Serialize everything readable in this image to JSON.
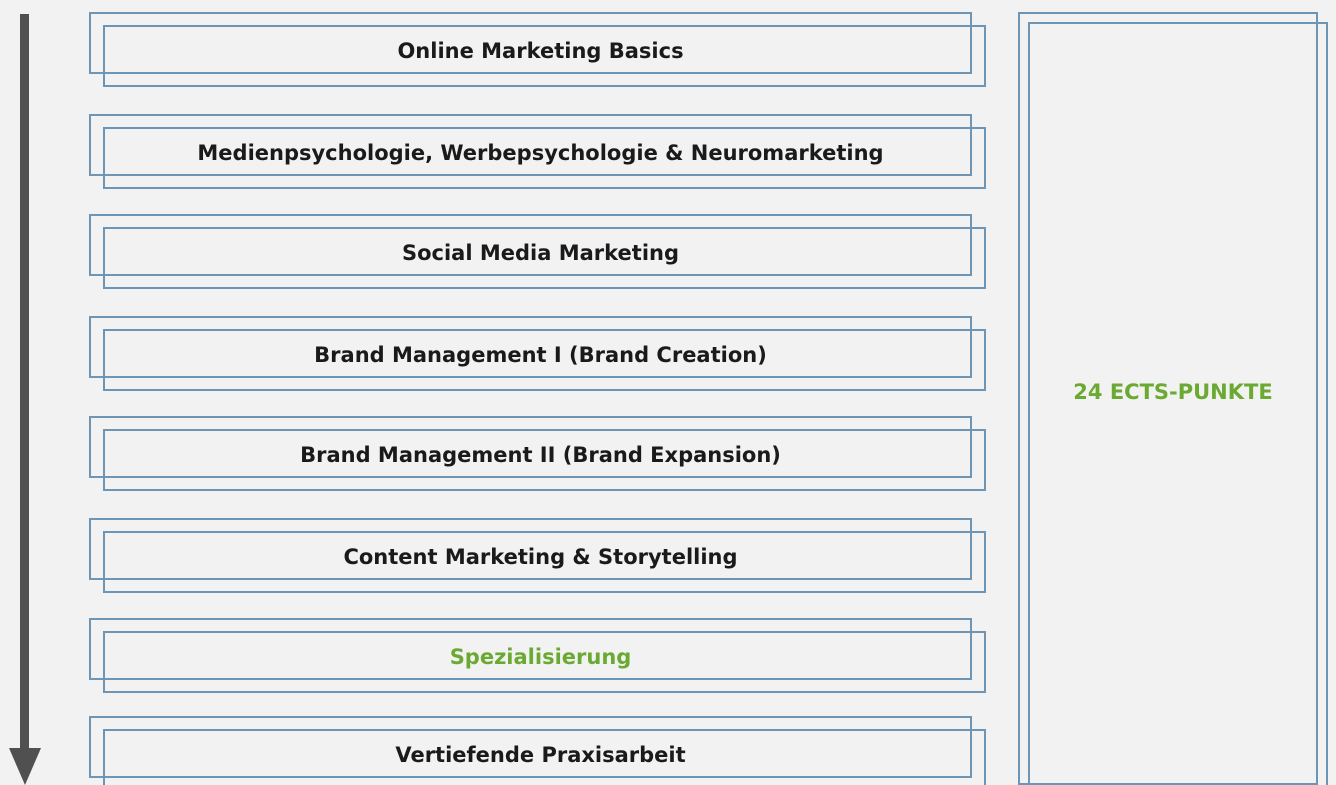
{
  "modules": [
    {
      "label": "Online Marketing Basics",
      "highlight": false
    },
    {
      "label": "Medienpsychologie, Werbepsychologie & Neuromarketing",
      "highlight": false
    },
    {
      "label": "Social Media Marketing",
      "highlight": false
    },
    {
      "label": "Brand Management I (Brand Creation)",
      "highlight": false
    },
    {
      "label": "Brand Management II (Brand Expansion)",
      "highlight": false
    },
    {
      "label": "Content Marketing & Storytelling",
      "highlight": false
    },
    {
      "label": "Spezialisierung",
      "highlight": true
    },
    {
      "label": "Vertiefende Praxisarbeit",
      "highlight": false
    }
  ],
  "summary": {
    "label": "24 ECTS-PUNKTE"
  },
  "colors": {
    "outline": "#6e96b4",
    "accent": "#6aaa32",
    "arrow": "#505050",
    "background": "#f2f2f2"
  }
}
